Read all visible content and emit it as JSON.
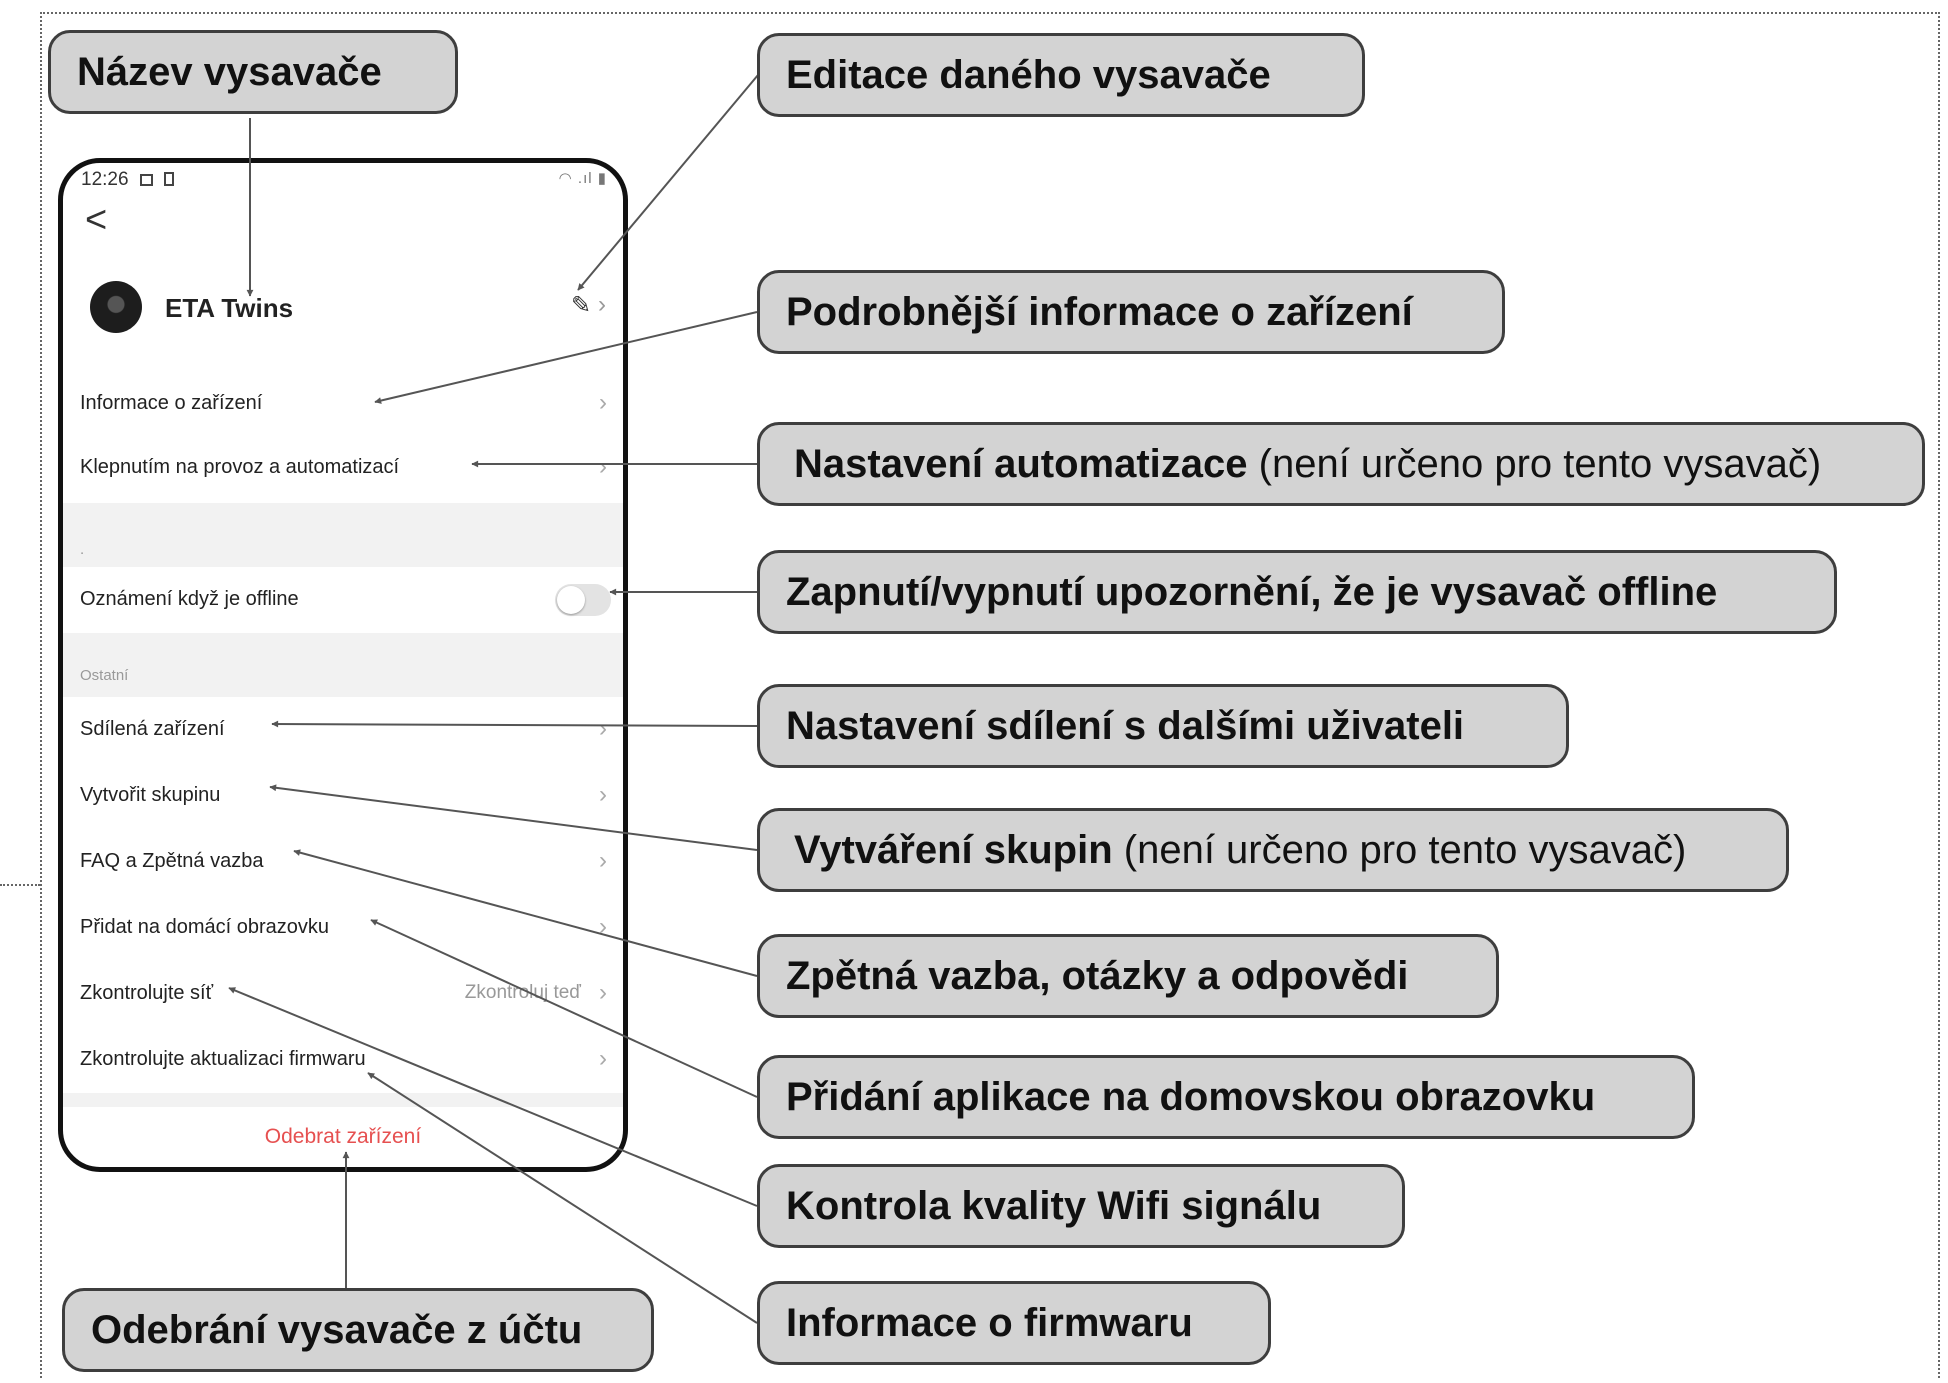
{
  "phone": {
    "status_time": "12:26",
    "device_name": "ETA Twins",
    "rows": {
      "device_info": "Informace o zařízení",
      "automation": "Klepnutím na provoz a automatizací",
      "section_dot": ".",
      "offline_notify": "Oznámení když je offline",
      "section_other": "Ostatní",
      "shared": "Sdílená zařízení",
      "create_group": "Vytvořit skupinu",
      "faq": "FAQ a Zpětná vazba",
      "home_screen": "Přidat na domácí obrazovku",
      "check_network": "Zkontrolujte síť",
      "check_network_value": "Zkontroluj teď",
      "firmware": "Zkontrolujte aktualizaci firmwaru"
    },
    "offline_toggle": "off",
    "remove_device": "Odebrat zařízení"
  },
  "callouts": {
    "name": "Název vysavače",
    "edit": "Editace daného vysavače",
    "info": "Podrobnější informace o zařízení",
    "automation_bold": "Nastavení automatizace",
    "automation_note": " (není určeno pro tento vysavač)",
    "offline": "Zapnutí/vypnutí upozornění, že je vysavač offline",
    "sharing": "Nastavení sdílení s dalšími uživateli",
    "groups_bold": "Vytváření skupin",
    "groups_note": " (není určeno pro tento vysavač)",
    "feedback": "Zpětná vazba, otázky a odpovědi",
    "home": "Přidání aplikace na domovskou obrazovku",
    "wifi": "Kontrola kvality Wifi signálu",
    "firmware": "Informace o firmwaru",
    "remove": "Odebrání vysavače z účtu"
  },
  "colors": {
    "callout_fill": "#d3d3d3",
    "remove_text": "#e65050",
    "arrow": "#555555"
  }
}
